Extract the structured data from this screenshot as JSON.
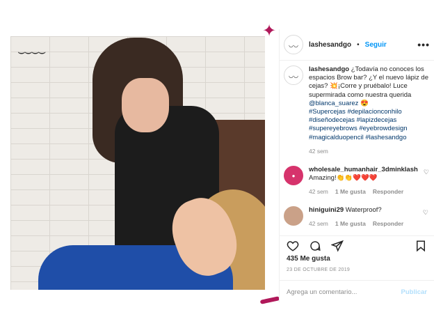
{
  "post": {
    "username": "lashesandgo",
    "separator": "•",
    "follow_label": "Seguir",
    "more_label": "•••",
    "avatar_text": "Lashes&Go"
  },
  "caption": {
    "username": "lashesandgo",
    "text_part1": " ¿Todavía no conoces los espacios Brow bar? ¿Y el nuevo lápiz de cejas? 💥¡Corre y pruébalo! Luce supermirada como nuestra querida ",
    "mention": "@blanca_suarez",
    "text_part2": " 😍",
    "hashtags": "#Supercejas #depilacionconhilo #diseñodecejas #lapizdecejas #supereyebrows #eyebrowdesign #magicalduopencil #lashesandgo",
    "time": "42 sem"
  },
  "comments": [
    {
      "username": "wholesale_humanhair_3dminklash",
      "text": "Amazing!👏👏❤️❤️❤️",
      "time": "42 sem",
      "likes": "1 Me gusta",
      "reply": "Responder"
    },
    {
      "username": "hiniguini29",
      "text": "Waterproof?",
      "time": "42 sem",
      "likes": "1 Me gusta",
      "reply": "Responder"
    }
  ],
  "engagement": {
    "likes": "435 Me gusta",
    "date": "23 DE OCTUBRE DE 2019"
  },
  "comment_box": {
    "placeholder": "Agrega un comentario...",
    "publish_label": "Publicar"
  },
  "colors": {
    "link_blue": "#0095f6",
    "hashtag_blue": "#00376b",
    "muted": "#8e8e8e",
    "accent_pink": "#b0185a"
  }
}
